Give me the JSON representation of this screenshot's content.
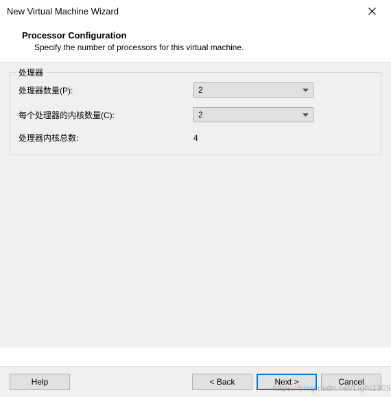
{
  "titlebar": {
    "title": "New Virtual Machine Wizard"
  },
  "header": {
    "title": "Processor Configuration",
    "subtitle": "Specify the number of processors for this virtual machine."
  },
  "fieldset": {
    "legend": "处理器",
    "rows": {
      "num_processors": {
        "label": "处理器数量(P):",
        "value": "2"
      },
      "cores_per_processor": {
        "label": "每个处理器的内核数量(C):",
        "value": "2"
      },
      "total_cores": {
        "label": "处理器内核总数:",
        "value": "4"
      }
    }
  },
  "footer": {
    "help": "Help",
    "back": "< Back",
    "next": "Next >",
    "cancel": "Cancel"
  },
  "watermark": "https://blog.csdn.net/Light1309"
}
